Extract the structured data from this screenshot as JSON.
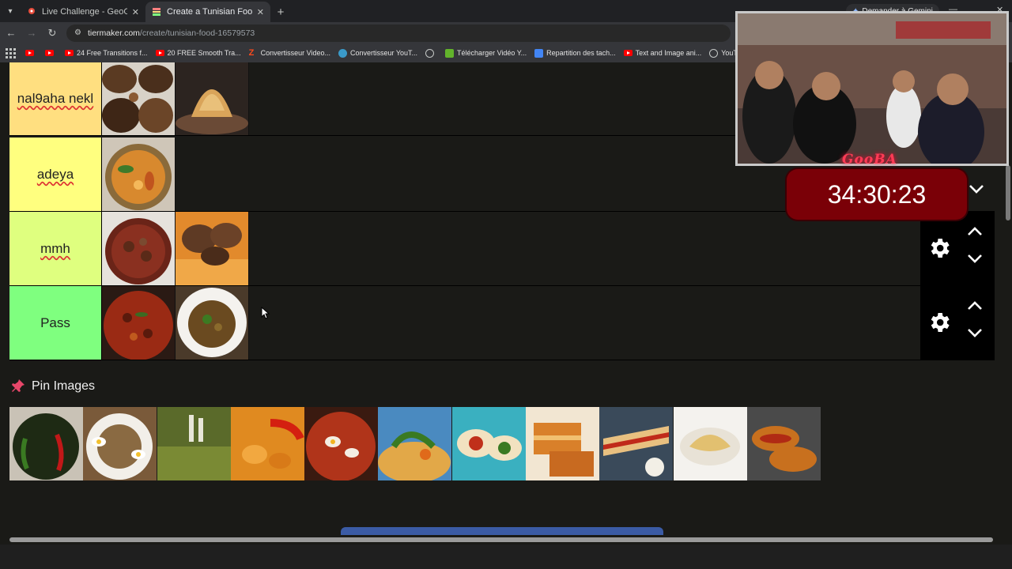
{
  "browser": {
    "tabs": [
      {
        "title": "Live Challenge - GeoGuessr",
        "active": false
      },
      {
        "title": "Create a Tunisian Food Tier List",
        "active": true
      }
    ],
    "gemini_label": "Demander à Gemini",
    "url_domain": "tiermaker.com",
    "url_path": "/create/tunisian-food-16579573",
    "bookmarks": [
      {
        "label": "",
        "icon": "youtube-icon"
      },
      {
        "label": "",
        "icon": "youtube-icon"
      },
      {
        "label": "24 Free Transitions f...",
        "icon": "youtube-icon"
      },
      {
        "label": "20 FREE Smooth Tra...",
        "icon": "youtube-icon"
      },
      {
        "label": "Convertisseur Video...",
        "icon": "z-icon"
      },
      {
        "label": "Convertisseur YouT...",
        "icon": "convert-icon"
      },
      {
        "label": "",
        "icon": "globe-icon"
      },
      {
        "label": "Télécharger Vidéo Y...",
        "icon": "download-icon"
      },
      {
        "label": "Repartition des tach...",
        "icon": "docs-icon"
      },
      {
        "label": "Text and Image ani...",
        "icon": "youtube-icon"
      },
      {
        "label": "YouTube Converter...",
        "icon": "globe-icon"
      }
    ]
  },
  "tiers": [
    {
      "label": "nal9aha nekl",
      "color": "#ffdf80",
      "items": 2,
      "controls": false
    },
    {
      "label": "adeya",
      "color": "#ffff7f",
      "items": 1,
      "controls": false
    },
    {
      "label": "mmh",
      "color": "#dfff7f",
      "items": 2,
      "controls": true
    },
    {
      "label": "Pass",
      "color": "#7fff7f",
      "items": 2,
      "controls": true
    }
  ],
  "pin_images": {
    "title": "Pin Images",
    "count": 11
  },
  "overlay": {
    "timer": "34:30:23",
    "channel": "GooBA"
  }
}
